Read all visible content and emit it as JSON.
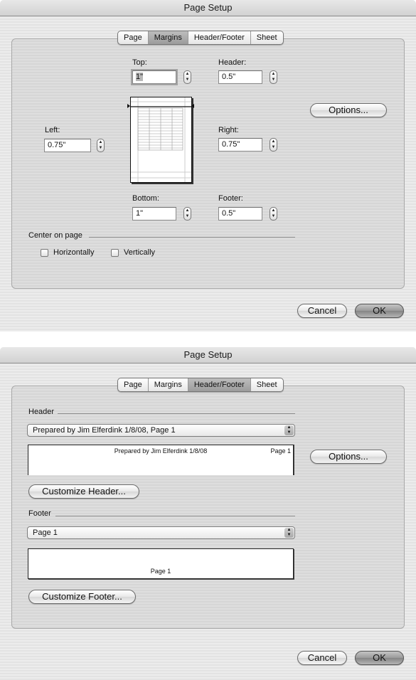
{
  "dialogs": [
    {
      "title": "Page Setup",
      "tabs": [
        {
          "label": "Page",
          "selected": false
        },
        {
          "label": "Margins",
          "selected": true
        },
        {
          "label": "Header/Footer",
          "selected": false
        },
        {
          "label": "Sheet",
          "selected": false
        }
      ],
      "margins": {
        "top": {
          "label": "Top:",
          "value": "1\""
        },
        "header": {
          "label": "Header:",
          "value": "0.5\""
        },
        "left": {
          "label": "Left:",
          "value": "0.75\""
        },
        "right": {
          "label": "Right:",
          "value": "0.75\""
        },
        "bottom": {
          "label": "Bottom:",
          "value": "1\""
        },
        "footer": {
          "label": "Footer:",
          "value": "0.5\""
        }
      },
      "center_on_page": {
        "label": "Center on page",
        "horizontally": {
          "label": "Horizontally",
          "checked": false
        },
        "vertically": {
          "label": "Vertically",
          "checked": false
        }
      },
      "options_label": "Options...",
      "cancel_label": "Cancel",
      "ok_label": "OK"
    },
    {
      "title": "Page Setup",
      "tabs": [
        {
          "label": "Page",
          "selected": false
        },
        {
          "label": "Margins",
          "selected": false
        },
        {
          "label": "Header/Footer",
          "selected": true
        },
        {
          "label": "Sheet",
          "selected": false
        }
      ],
      "header": {
        "label": "Header",
        "selected": "Prepared by Jim Elferdink 1/8/08, Page 1",
        "preview_center": "Prepared by Jim Elferdink 1/8/08",
        "preview_right": "Page 1",
        "customize_label": "Customize Header..."
      },
      "footer": {
        "label": "Footer",
        "selected": "Page 1",
        "preview_center": "Page 1",
        "customize_label": "Customize Footer..."
      },
      "options_label": "Options...",
      "cancel_label": "Cancel",
      "ok_label": "OK"
    }
  ]
}
